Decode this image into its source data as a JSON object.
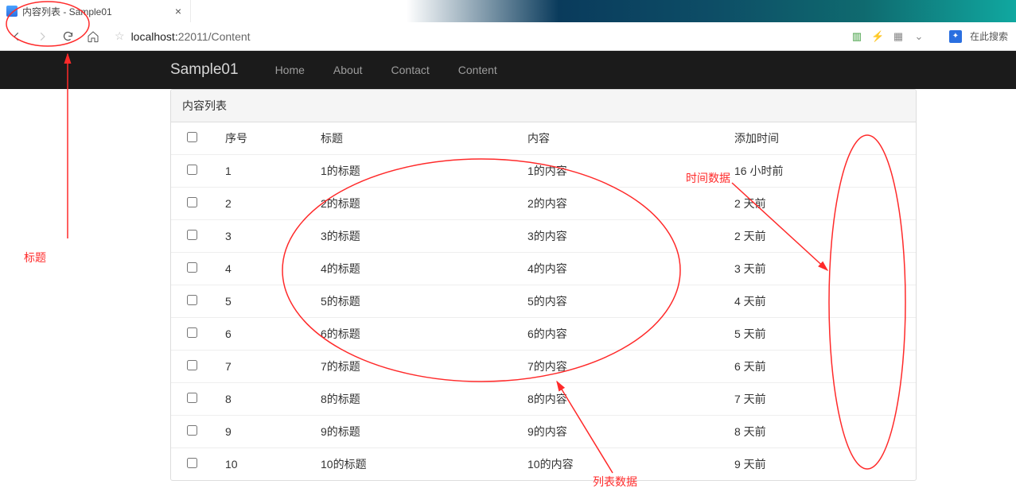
{
  "browser": {
    "tab_title": "内容列表 - Sample01",
    "url_host": "localhost:",
    "url_port_path": "22011/Content",
    "search_placeholder": "在此搜索"
  },
  "navbar": {
    "brand": "Sample01",
    "links": [
      "Home",
      "About",
      "Contact",
      "Content"
    ]
  },
  "panel": {
    "title": "内容列表",
    "headers": {
      "chk": "",
      "index": "序号",
      "title": "标题",
      "content": "内容",
      "time": "添加时间"
    },
    "rows": [
      {
        "index": "1",
        "title": "1的标题",
        "content": "1的内容",
        "time": "16 小时前"
      },
      {
        "index": "2",
        "title": "2的标题",
        "content": "2的内容",
        "time": "2 天前"
      },
      {
        "index": "3",
        "title": "3的标题",
        "content": "3的内容",
        "time": "2 天前"
      },
      {
        "index": "4",
        "title": "4的标题",
        "content": "4的内容",
        "time": "3 天前"
      },
      {
        "index": "5",
        "title": "5的标题",
        "content": "5的内容",
        "time": "4 天前"
      },
      {
        "index": "6",
        "title": "6的标题",
        "content": "6的内容",
        "time": "5 天前"
      },
      {
        "index": "7",
        "title": "7的标题",
        "content": "7的内容",
        "time": "6 天前"
      },
      {
        "index": "8",
        "title": "8的标题",
        "content": "8的内容",
        "time": "7 天前"
      },
      {
        "index": "9",
        "title": "9的标题",
        "content": "9的内容",
        "time": "8 天前"
      },
      {
        "index": "10",
        "title": "10的标题",
        "content": "10的内容",
        "time": "9 天前"
      }
    ]
  },
  "annotations": {
    "title_label": "标题",
    "time_label": "时间数据",
    "list_label": "列表数据"
  }
}
